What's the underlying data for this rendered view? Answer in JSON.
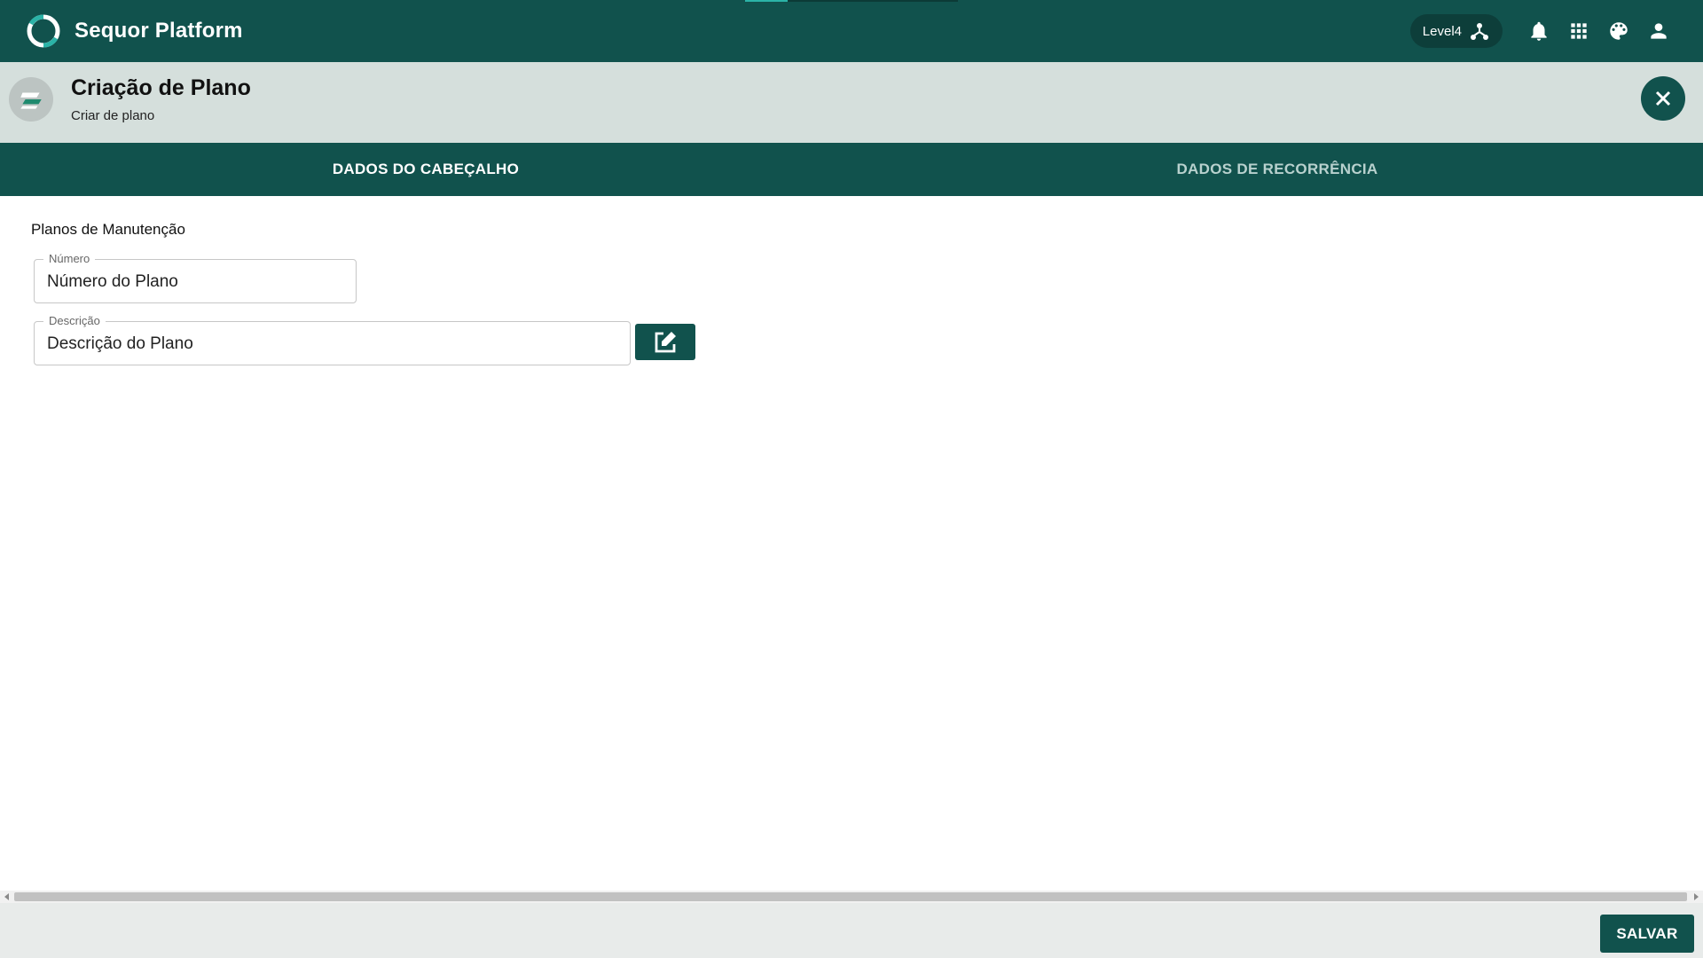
{
  "app": {
    "title": "Sequor Platform",
    "level_label": "Level4"
  },
  "header_icons": [
    "hierarchy-icon",
    "bell-icon",
    "apps-grid-icon",
    "palette-icon",
    "user-icon"
  ],
  "page": {
    "title": "Criação de Plano",
    "subtitle": "Criar de plano"
  },
  "tabs": [
    {
      "label": "DADOS DO CABEÇALHO",
      "active": true
    },
    {
      "label": "DADOS DE RECORRÊNCIA",
      "active": false
    }
  ],
  "form": {
    "section_title": "Planos de Manutenção",
    "numero": {
      "label": "Número",
      "value": "Número do Plano"
    },
    "descricao": {
      "label": "Descrição",
      "value": "Descrição do Plano"
    }
  },
  "footer": {
    "save_label": "SALVAR"
  },
  "colors": {
    "primary": "#11524d",
    "header_bg": "#d5dfdc",
    "footer_bg": "#e8ebea",
    "accent": "#2bb3a7"
  }
}
